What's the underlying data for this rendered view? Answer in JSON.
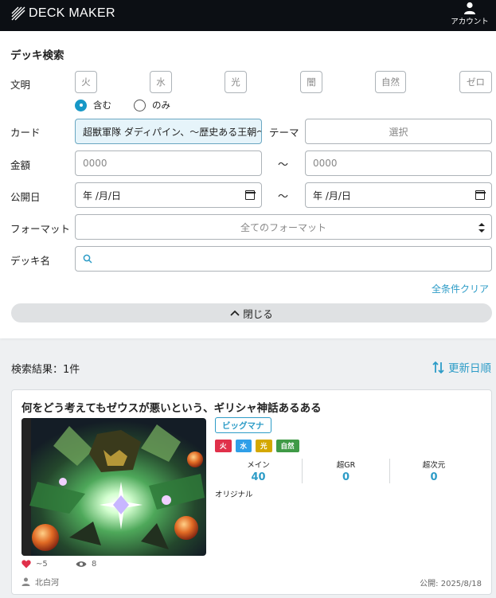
{
  "app": {
    "logo_text": "DECK MAKER",
    "account_label": "アカウント"
  },
  "search": {
    "title": "デッキ検索",
    "civ_label": "文明",
    "civilizations": [
      "火",
      "水",
      "光",
      "闇",
      "自然",
      "ゼロ"
    ],
    "match_modes": [
      "含む",
      "のみ"
    ],
    "selected_match_mode": "含む",
    "card_label": "カード",
    "card_value": "超獣軍隊 ダディパイン、〜歴史ある王朝〜",
    "theme_label": "テーマ",
    "theme_placeholder": "選択",
    "price_label": "金額",
    "price_min_placeholder": "0000",
    "price_max_placeholder": "0000",
    "range_sep": "〜",
    "date_label": "公開日",
    "date_from_placeholder": "年 /月/日",
    "date_to_placeholder": "年 /月/日",
    "format_label": "フォーマット",
    "format_value": "全てのフォーマット",
    "deck_name_label": "デッキ名",
    "deck_name_value": "",
    "clear_label": "全条件クリア",
    "close_label": "閉じる"
  },
  "results": {
    "label": "検索結果：1件",
    "sort_label": "更新日順"
  },
  "deck": {
    "title": "何をどう考えてもゼウスが悪いという、ギリシャ神話あるある",
    "format_badge": "ビッグマナ",
    "civs": [
      {
        "name": "火",
        "color": "#e0304a"
      },
      {
        "name": "水",
        "color": "#2f9fe8"
      },
      {
        "name": "光",
        "color": "#d4a800"
      },
      {
        "name": "自然",
        "color": "#3f9a46"
      }
    ],
    "counts": [
      {
        "label": "メイン",
        "value": "40"
      },
      {
        "label": "超GR",
        "value": "0"
      },
      {
        "label": "超次元",
        "value": "0"
      }
    ],
    "original_label": "オリジナル",
    "likes": "~5",
    "views": "8",
    "author": "北白河",
    "published": "公開: 2025/8/18"
  },
  "colors": {
    "accent": "#2d9cc7",
    "topbar": "#0c0f14",
    "like": "#e0304a"
  }
}
